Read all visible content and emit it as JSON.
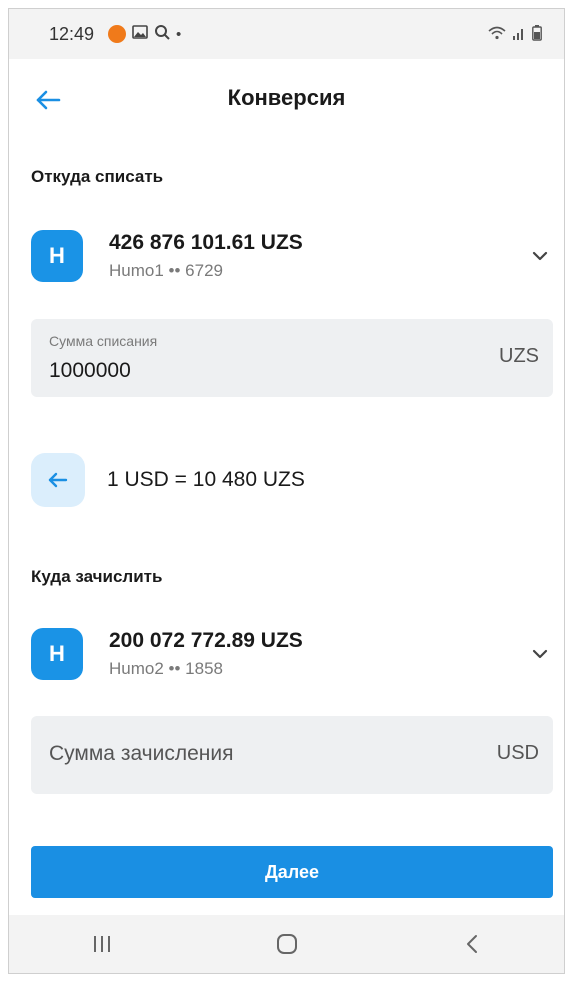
{
  "status_bar": {
    "time": "12:49",
    "icons": [
      "notification-dot-icon",
      "gallery-icon",
      "search-icon",
      "dot-icon",
      "wifi-icon",
      "signal-icon",
      "battery-icon"
    ]
  },
  "header": {
    "title": "Конверсия"
  },
  "from_section": {
    "label": "Откуда списать",
    "account": {
      "logo_text": "H",
      "balance": "426 876 101.61 UZS",
      "card_name": "Humo1",
      "card_mask": "•• 6729"
    },
    "amount_field": {
      "label": "Сумма списания",
      "value": "1000000",
      "currency": "UZS"
    }
  },
  "rate": {
    "text": "1 USD = 10 480 UZS"
  },
  "to_section": {
    "label": "Куда зачислить",
    "account": {
      "logo_text": "H",
      "balance": "200 072 772.89 UZS",
      "card_name": "Humo2",
      "card_mask": "•• 1858"
    },
    "amount_field": {
      "placeholder": "Сумма зачисления",
      "currency": "USD"
    }
  },
  "actions": {
    "next_label": "Далее"
  },
  "nav": {
    "items": [
      "recent-apps-icon",
      "home-icon",
      "back-icon"
    ]
  },
  "colors": {
    "accent": "#1a8fe3",
    "logo": "#1a93e6",
    "field_bg": "#eef0f2",
    "swap_bg": "#dbeefc"
  }
}
